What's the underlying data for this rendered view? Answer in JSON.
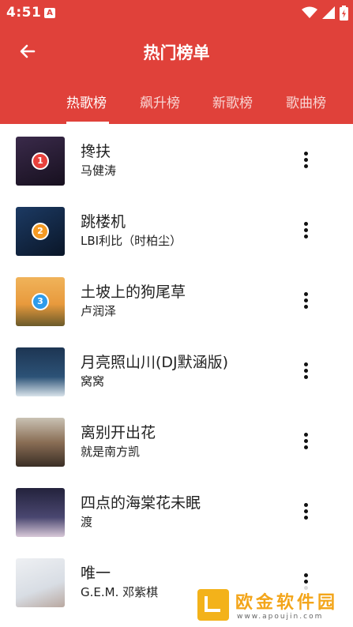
{
  "status_bar": {
    "time": "4:51",
    "notification_icon_letter": "A",
    "icons": [
      "wifi-icon",
      "signal-icon",
      "battery-charging-icon"
    ]
  },
  "toolbar": {
    "back_icon": "arrow-left-icon",
    "title": "热门榜单"
  },
  "tabs": [
    {
      "label": "热歌榜",
      "active": true
    },
    {
      "label": "飙升榜",
      "active": false
    },
    {
      "label": "新歌榜",
      "active": false
    },
    {
      "label": "歌曲榜",
      "active": false
    }
  ],
  "songs": [
    {
      "rank": "1",
      "title": "搀扶",
      "artist": "马健涛",
      "badge_color": "#e8413c"
    },
    {
      "rank": "2",
      "title": "跳楼机",
      "artist": "LBI利比（时柏尘）",
      "badge_color": "#f59a23"
    },
    {
      "rank": "3",
      "title": "土坡上的狗尾草",
      "artist": "卢润泽",
      "badge_color": "#2e9bea"
    },
    {
      "rank": "",
      "title": "月亮照山川(DJ默涵版)",
      "artist": "窝窝"
    },
    {
      "rank": "",
      "title": "离别开出花",
      "artist": "就是南方凯"
    },
    {
      "rank": "",
      "title": "四点的海棠花未眠",
      "artist": "渡"
    },
    {
      "rank": "",
      "title": "唯一",
      "artist": "G.E.M. 邓紫棋"
    }
  ],
  "more_icon": "more-vertical-icon",
  "colors": {
    "header": "#e0413a",
    "text": "#222222",
    "watermark": "#f3a51a"
  },
  "watermark": {
    "title": "欧金软件园",
    "url": "www.apoujin.com"
  }
}
